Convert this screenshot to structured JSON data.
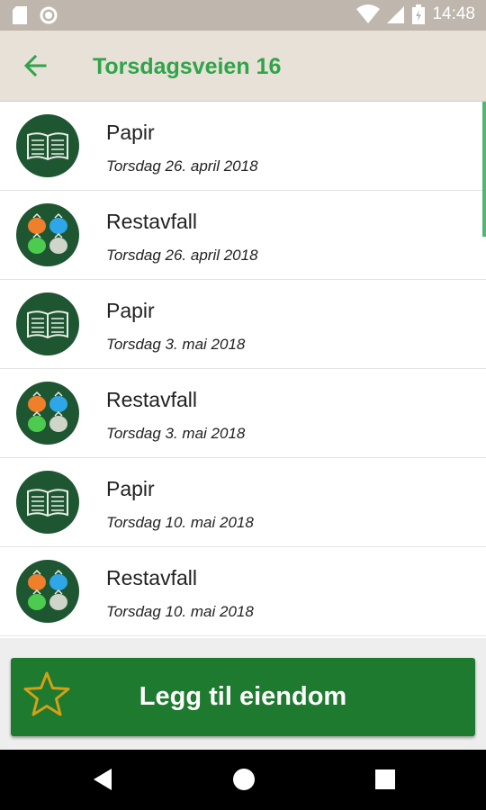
{
  "status_bar": {
    "time": "14:48",
    "left_icons": [
      "sd-card-icon",
      "circle-notification-icon"
    ],
    "right_icons": [
      "wifi-icon",
      "signal-icon",
      "battery-charging-icon"
    ]
  },
  "app_bar": {
    "back_icon": "back-arrow-icon",
    "title": "Torsdagsveien 16",
    "title_color": "#2fa448"
  },
  "schedule": [
    {
      "type": "Papir",
      "date": "Torsdag 26. april 2018",
      "icon": "paper-book-icon"
    },
    {
      "type": "Restavfall",
      "date": "Torsdag 26. april 2018",
      "icon": "waste-bags-icon"
    },
    {
      "type": "Papir",
      "date": "Torsdag 3. mai 2018",
      "icon": "paper-book-icon"
    },
    {
      "type": "Restavfall",
      "date": "Torsdag 3. mai 2018",
      "icon": "waste-bags-icon"
    },
    {
      "type": "Papir",
      "date": "Torsdag 10. mai 2018",
      "icon": "paper-book-icon"
    },
    {
      "type": "Restavfall",
      "date": "Torsdag 10. mai 2018",
      "icon": "waste-bags-icon"
    }
  ],
  "add_button": {
    "label": "Legg til eiendom",
    "icon": "star-outline-icon",
    "color": "#1e7a2e"
  },
  "nav_bar": {
    "buttons": [
      "back-triangle-icon",
      "home-circle-icon",
      "recents-square-icon"
    ]
  }
}
